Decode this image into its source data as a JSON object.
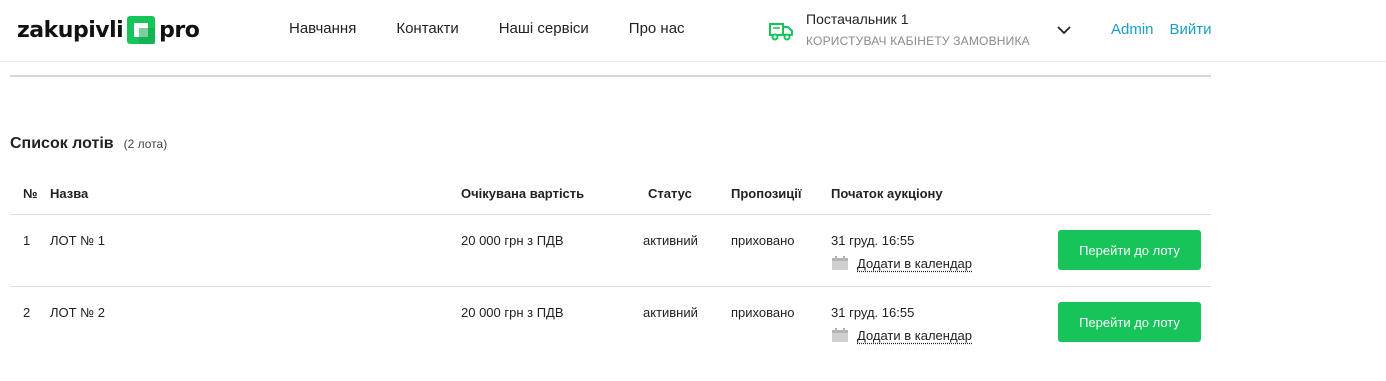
{
  "logo": {
    "left": "zakupivli",
    "right": "pro"
  },
  "nav": [
    "Навчання",
    "Контакти",
    "Наші сервіси",
    "Про нас"
  ],
  "supplier": {
    "name": "Постачальник 1",
    "role": "КОРИСТУВАЧ КАБІНЕТУ ЗАМОВНИКА"
  },
  "user_links": {
    "admin": "Admin",
    "logout": "Вийти"
  },
  "lots": {
    "title": "Список лотів",
    "count": "(2 лота)",
    "headers": {
      "num": "№",
      "name": "Назва",
      "price": "Очікувана вартість",
      "status": "Статус",
      "offers": "Пропозиції",
      "start": "Початок аукціону"
    },
    "rows": [
      {
        "num": "1",
        "name": "ЛОТ № 1",
        "price": "20 000 грн з ПДВ",
        "status": "активний",
        "offers": "приховано",
        "start": "31 груд. 16:55",
        "calendar": "Додати в календар",
        "button": "Перейти до лоту"
      },
      {
        "num": "2",
        "name": "ЛОТ № 2",
        "price": "20 000 грн з ПДВ",
        "status": "активний",
        "offers": "приховано",
        "start": "31 груд. 16:55",
        "calendar": "Додати в календар",
        "button": "Перейти до лоту"
      }
    ]
  },
  "colors": {
    "accent_green": "#16c45a",
    "link_blue": "#1a9fc9"
  }
}
